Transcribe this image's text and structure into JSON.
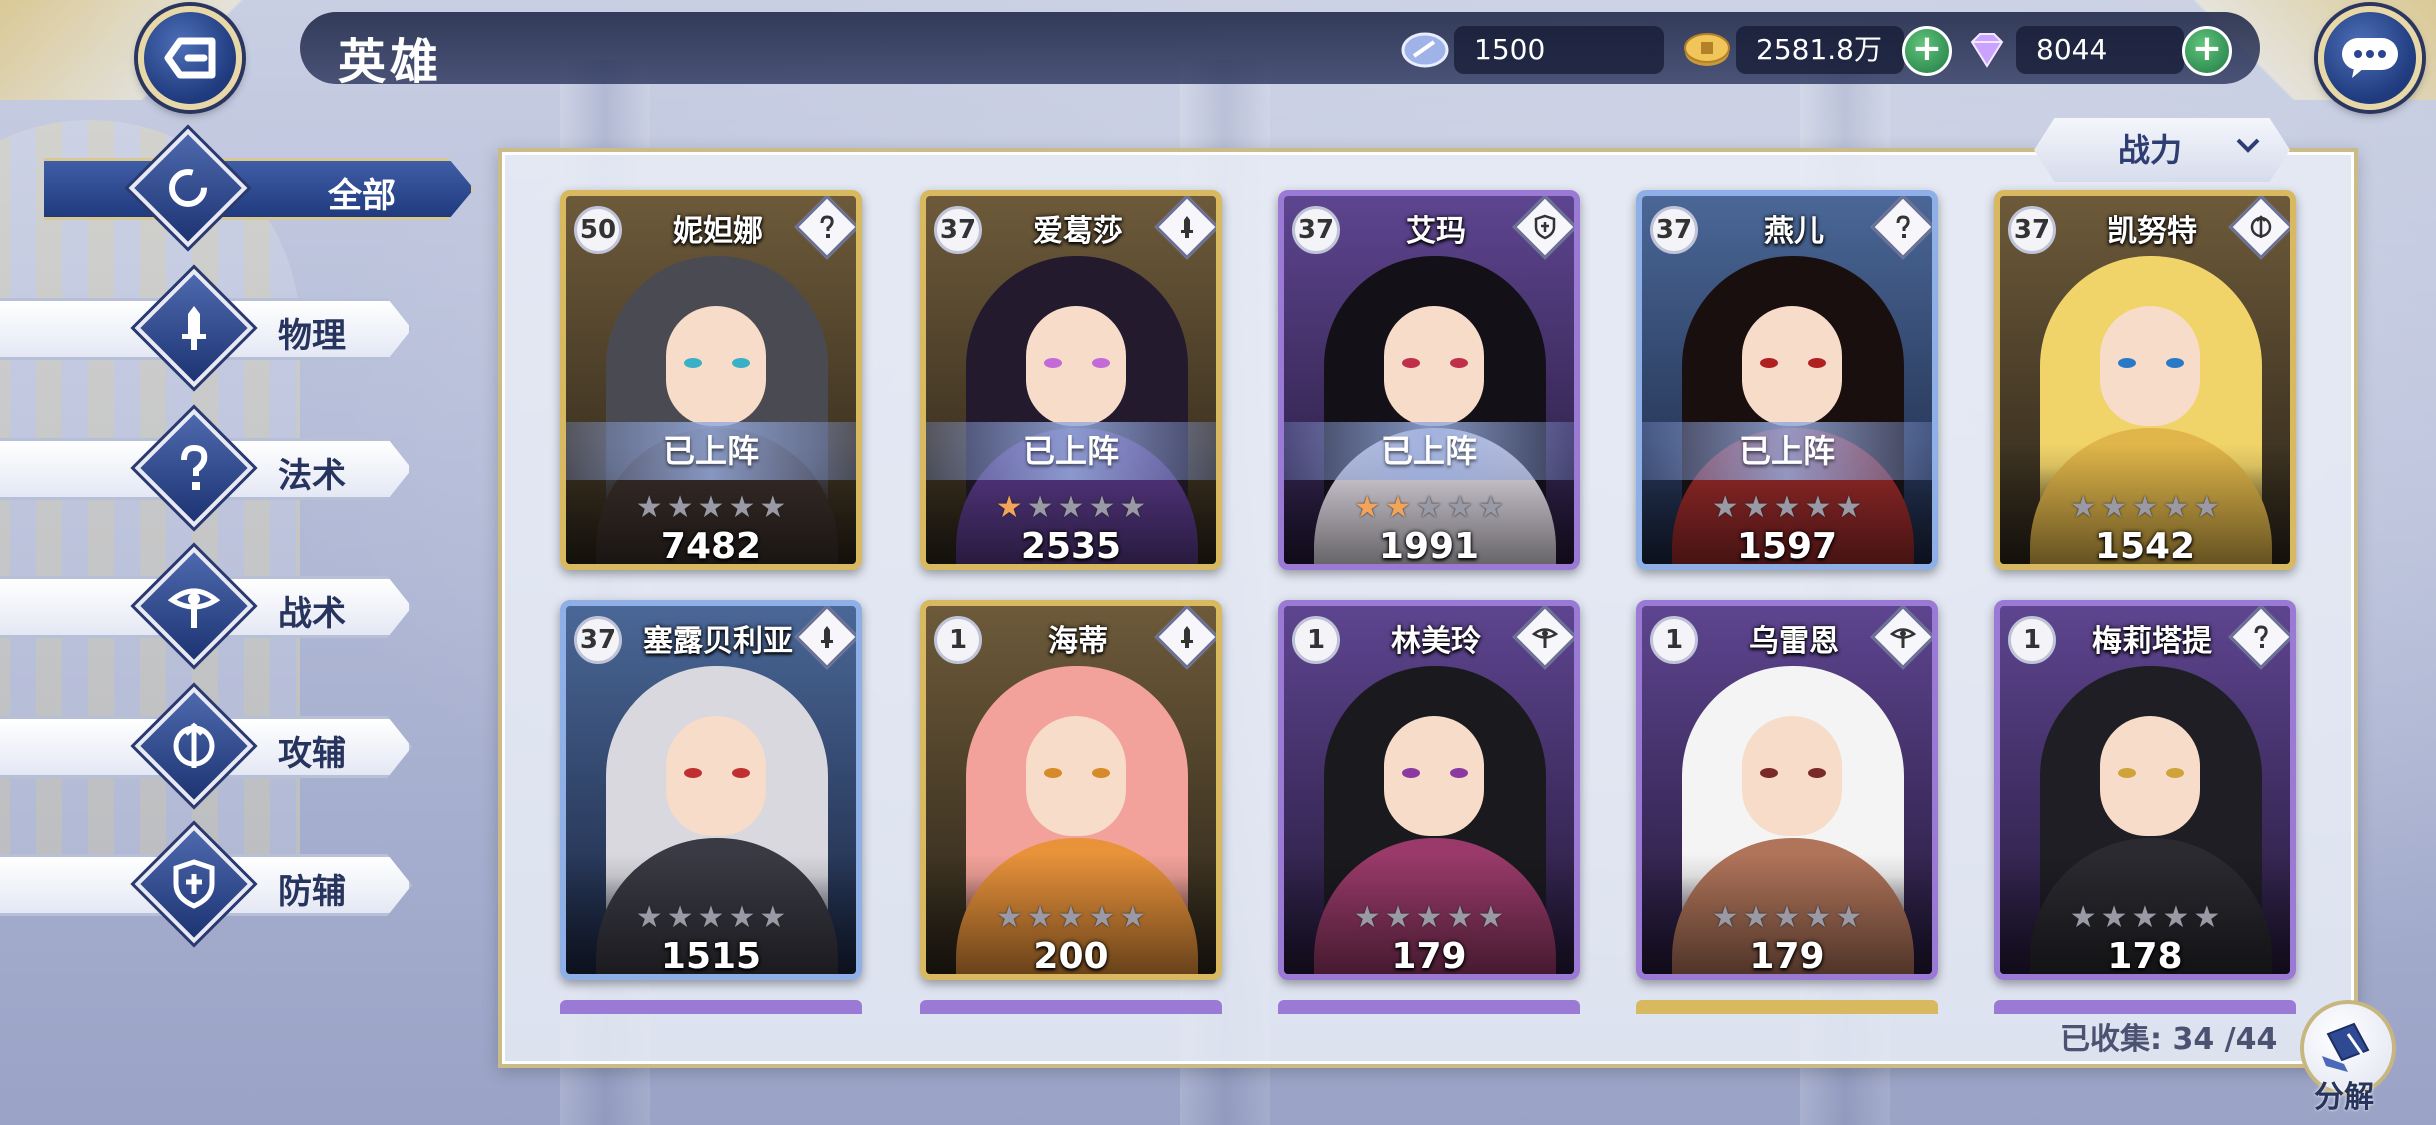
{
  "header": {
    "title": "英雄",
    "resources": [
      {
        "icon": "stamina-crystal-icon",
        "value": "1500"
      },
      {
        "icon": "gold-coin-icon",
        "value": "2581.8万"
      },
      {
        "icon": "diamond-gem-icon",
        "value": "8044"
      }
    ]
  },
  "sidebar": {
    "items": [
      {
        "label": "全部",
        "icon": "all-ring-icon",
        "active": true
      },
      {
        "label": "物理",
        "icon": "physical-sword-icon",
        "active": false
      },
      {
        "label": "法术",
        "icon": "magic-question-icon",
        "active": false
      },
      {
        "label": "战术",
        "icon": "tactics-eye-icon",
        "active": false
      },
      {
        "label": "攻辅",
        "icon": "attack-support-icon",
        "active": false
      },
      {
        "label": "防辅",
        "icon": "defense-shield-icon",
        "active": false
      }
    ]
  },
  "sort": {
    "label": "战力"
  },
  "deployed_label": "已上阵",
  "heroes": [
    {
      "level": "50",
      "name": "妮妲娜",
      "power": "7482",
      "stars": 0,
      "deployed": true,
      "frame": "gold",
      "type": "magic"
    },
    {
      "level": "37",
      "name": "爱葛莎",
      "power": "2535",
      "stars": 1,
      "deployed": true,
      "frame": "gold",
      "type": "physical"
    },
    {
      "level": "37",
      "name": "艾玛",
      "power": "1991",
      "stars": 2,
      "deployed": true,
      "frame": "purple",
      "type": "defense"
    },
    {
      "level": "37",
      "name": "燕儿",
      "power": "1597",
      "stars": 0,
      "deployed": true,
      "frame": "blue",
      "type": "magic"
    },
    {
      "level": "37",
      "name": "凯努特",
      "power": "1542",
      "stars": 0,
      "deployed": false,
      "frame": "gold",
      "type": "attack"
    },
    {
      "level": "37",
      "name": "塞露贝利亚",
      "power": "1515",
      "stars": 0,
      "deployed": false,
      "frame": "blue",
      "type": "physical"
    },
    {
      "level": "1",
      "name": "海蒂",
      "power": "200",
      "stars": 0,
      "deployed": false,
      "frame": "gold",
      "type": "physical"
    },
    {
      "level": "1",
      "name": "林美玲",
      "power": "179",
      "stars": 0,
      "deployed": false,
      "frame": "purple",
      "type": "tactics"
    },
    {
      "level": "1",
      "name": "乌雷恩",
      "power": "179",
      "stars": 0,
      "deployed": false,
      "frame": "purple",
      "type": "tactics"
    },
    {
      "level": "1",
      "name": "梅莉塔提",
      "power": "178",
      "stars": 0,
      "deployed": false,
      "frame": "purple",
      "type": "magic"
    }
  ],
  "collection": {
    "text": "已收集: 34 /44"
  },
  "decompose": {
    "label": "分解"
  },
  "colors": {
    "gold_frame": "#d8b95f",
    "purple_frame": "#9b7ad6",
    "blue_frame": "#8fb0e6",
    "accent_blue": "#203a7e",
    "star_on": "#f2a45a"
  }
}
